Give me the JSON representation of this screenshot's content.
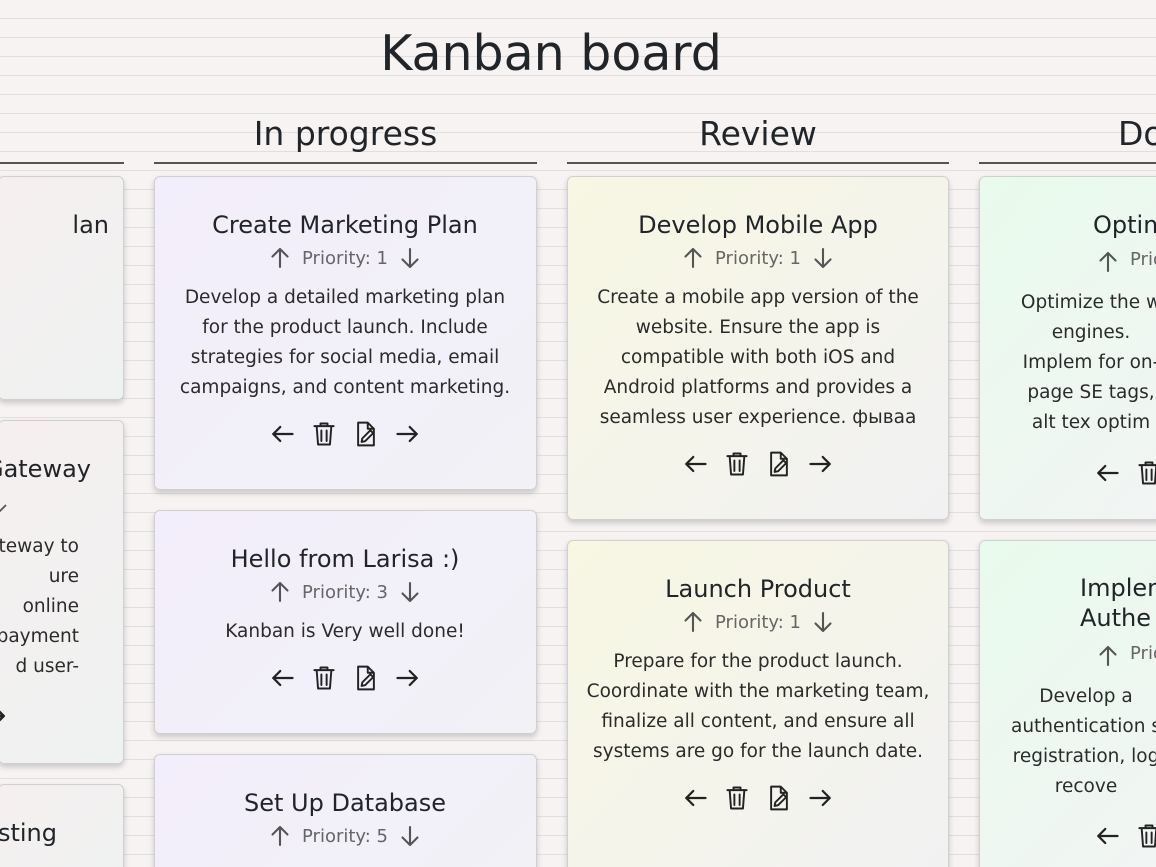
{
  "board": {
    "title": "Kanban board"
  },
  "columns": [
    {
      "title": ""
    },
    {
      "title": "In progress"
    },
    {
      "title": "Review"
    },
    {
      "title": "Do"
    }
  ],
  "cards": {
    "c0_0": {
      "title": "lan",
      "priority": "",
      "description": ""
    },
    "c0_1": {
      "title": "Gateway",
      "priority": "",
      "description": "teway to ure online payment d user-"
    },
    "c0_2": {
      "title": "sting",
      "priority": "",
      "description": ""
    },
    "c1_0": {
      "title": "Create Marketing Plan",
      "priority": "Priority: 1",
      "description": "Develop a detailed marketing plan for the product launch. Include strategies for social media, email campaigns, and content marketing."
    },
    "c1_1": {
      "title": "Hello from Larisa :)",
      "priority": "Priority: 3",
      "description": "Kanban is Very well done!"
    },
    "c1_2": {
      "title": "Set Up Database",
      "priority": "Priority: 5",
      "description": ""
    },
    "c2_0": {
      "title": "Develop Mobile App",
      "priority": "Priority: 1",
      "description": "Create a mobile app version of the website. Ensure the app is compatible with both iOS and Android platforms and provides a seamless user experience. фываа"
    },
    "c2_1": {
      "title": "Launch Product",
      "priority": "Priority: 1",
      "description": "Prepare for the product launch. Coordinate with the marketing team, finalize all content, and ensure all systems are go for the launch date."
    },
    "c3_0": {
      "title": "Optim",
      "priority": "Prio",
      "description": "Optimize the w engines. Implem for on-page SE tags, alt tex optim"
    },
    "c3_1": {
      "title": "Implem Authe",
      "priority": "Prio",
      "description": "Develop a authentication s registration, log recove"
    }
  },
  "icons": {
    "up": "arrow-up-icon",
    "down": "arrow-down-icon",
    "left": "arrow-left-icon",
    "right": "arrow-right-icon",
    "delete": "trash-icon",
    "edit": "edit-file-icon"
  },
  "colors": {
    "purple_card": "#f3eefb",
    "yellow_card": "#f8f7e2",
    "green_card": "#e8fbec",
    "text": "#212529",
    "muted": "#666666"
  }
}
